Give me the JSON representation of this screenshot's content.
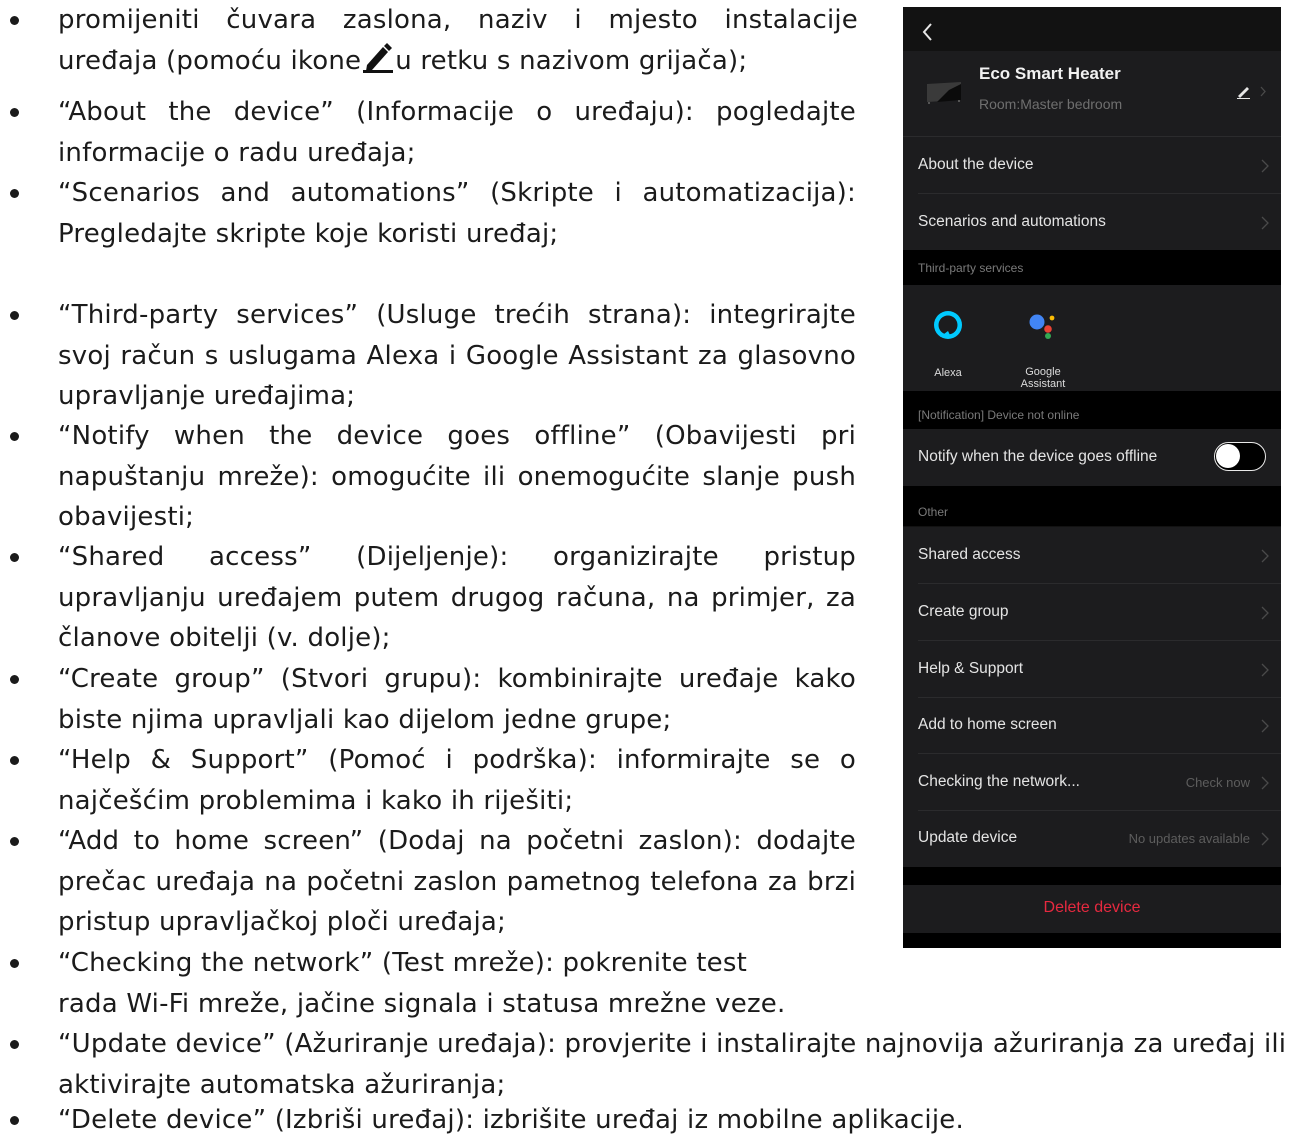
{
  "bullets": [
    {
      "lines": [
        "promijeniti čuvara zaslona, naziv i mjesto instalacije",
        "uređaja (pomoću ikone",
        "u retku s nazivom grijača);"
      ],
      "icon": "pencil-icon"
    },
    {
      "text": "“About the device” (Informacije o uređaju): pogledajte informacije o radu uređaja;"
    },
    {
      "text": "“Scenarios and automations” (Skripte i automatizacija): Pregledajte skripte koje koristi uređaj;"
    },
    {
      "text": "“Third-party services” (Usluge trećih strana): integrirajte svoj račun s uslugama Alexa i Google Assistant za glasovno upravljanje uređajima;"
    },
    {
      "text": "“Notify when the device goes offline” (Obavijesti pri napuštanju mreže): omogućite ili onemogućite slanje push obavijesti;"
    },
    {
      "text": "“Shared access” (Dijeljenje): organizirajte pristup upravljanju uređajem putem drugog računa, na primjer, za članove obitelji (v. dolje);"
    },
    {
      "text": "“Create group” (Stvori grupu): kombinirajte uređaje kako biste njima upravljali kao dijelom jedne grupe;"
    },
    {
      "text": "“Help & Support” (Pomoć i podrška): informirajte se o najčešćim problemima i kako ih riješiti;"
    },
    {
      "text": "“Add to home screen” (Dodaj na početni zaslon): dodajte prečac uređaja na početni zaslon pametnog telefona za brzi pristup upravljačkoj ploči uređaja;"
    },
    {
      "lines": [
        "“Checking the network” (Test mreže): pokrenite test",
        "rada Wi-Fi mreže, jačine signala i statusa mrežne veze."
      ]
    },
    {
      "text": "“Update device” (Ažuriranje uređaja): provjerite i instalirajte najnovija ažuriranja za uređaj ili aktivirajte automatska ažuriranja;"
    },
    {
      "text": "“Delete device” (Izbriši uređaj): izbrišite uređaj iz mobilne aplikacije."
    }
  ],
  "phone": {
    "back_icon": "chevron-left-icon",
    "device": {
      "name": "Eco Smart Heater",
      "room": "Room:Master bedroom",
      "edit_icon": "pencil-icon"
    },
    "rows_top": [
      {
        "label": "About the device"
      },
      {
        "label": "Scenarios and automations"
      }
    ],
    "third_party_title": "Third-party services",
    "services": [
      {
        "name": "Alexa",
        "icon": "alexa-icon"
      },
      {
        "name_line1": "Google",
        "name_line2": "Assistant",
        "icon": "google-assistant-icon"
      }
    ],
    "notification_title": "[Notification] Device not online",
    "notify_row": {
      "label": "Notify when the device goes offline",
      "toggle_on": false
    },
    "other_title": "Other",
    "rows_other": [
      {
        "label": "Shared access",
        "value": ""
      },
      {
        "label": "Create group",
        "value": ""
      },
      {
        "label": "Help & Support",
        "value": ""
      },
      {
        "label": "Add to home screen",
        "value": ""
      },
      {
        "label": "Checking the network...",
        "value": "Check now"
      },
      {
        "label": "Update device",
        "value": "No updates available"
      }
    ],
    "delete_label": "Delete device",
    "colors": {
      "background": "#121212",
      "card": "#1c1c1e",
      "delete": "#e6293f",
      "alexa": "#00caff",
      "google_blue": "#4285f4"
    }
  }
}
